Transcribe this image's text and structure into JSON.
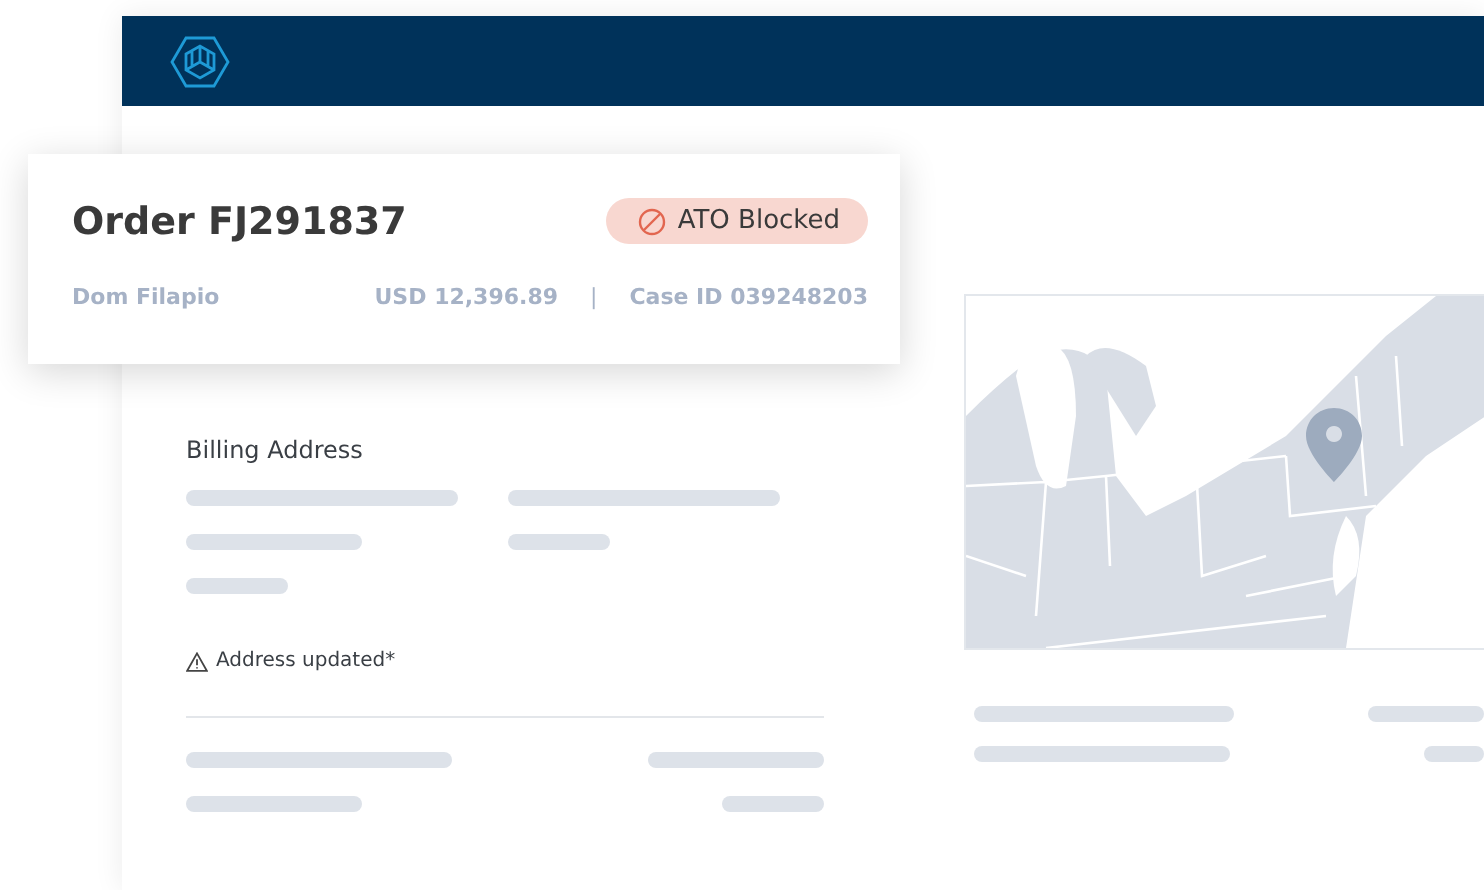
{
  "order_card": {
    "title": "Order FJ291837",
    "status": {
      "label": "ATO Blocked",
      "kind": "blocked"
    },
    "customer": "Dom Filapio",
    "amount": "USD 12,396.89",
    "separator": "|",
    "case_id": "Case ID 039248203"
  },
  "billing": {
    "heading": "Billing Address",
    "note": "Address updated*"
  }
}
